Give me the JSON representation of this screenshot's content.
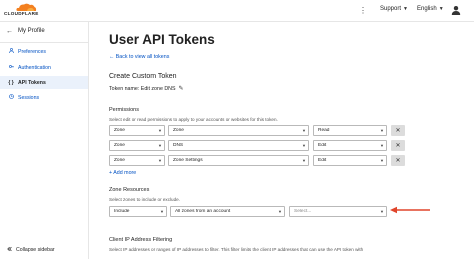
{
  "topbar": {
    "logo_text": "CLOUDFLARE",
    "support_label": "Support",
    "language_label": "English"
  },
  "sidebar": {
    "title": "My Profile",
    "items": [
      {
        "label": "Preferences",
        "icon": "user-icon",
        "active": false
      },
      {
        "label": "Authentication",
        "icon": "key-icon",
        "active": false
      },
      {
        "label": "API Tokens",
        "icon": "braces-icon",
        "active": true
      },
      {
        "label": "Sessions",
        "icon": "clock-icon",
        "active": false
      }
    ],
    "collapse_label": "Collapse sidebar"
  },
  "main": {
    "title": "User API Tokens",
    "back_link": "← Back to view all tokens",
    "section_title": "Create Custom Token",
    "token_name": "Token name: Edit zone DNS",
    "permissions": {
      "label": "Permissions",
      "help": "Select edit or read permissions to apply to your accounts or websites for this token.",
      "rows": [
        {
          "scope": "Zone",
          "resource": "Zone",
          "access": "Read"
        },
        {
          "scope": "Zone",
          "resource": "DNS",
          "access": "Edit"
        },
        {
          "scope": "Zone",
          "resource": "Zone Settings",
          "access": "Edit"
        }
      ],
      "add_more": "+ Add more"
    },
    "zone_resources": {
      "label": "Zone Resources",
      "help": "Select zones to include or exclude.",
      "include": "Include",
      "zones": "All zones from an account",
      "select_placeholder": "Select..."
    },
    "ip_filtering": {
      "label": "Client IP Address Filtering",
      "help": "Select IP addresses or ranges of IP addresses to filter. This filter limits the client IP addresses that can use the API token with"
    }
  },
  "colors": {
    "link": "#0051c3",
    "active_bg": "#eaf1fb",
    "annotation_arrow": "#e0452b",
    "logo_orange": "#f38020"
  }
}
